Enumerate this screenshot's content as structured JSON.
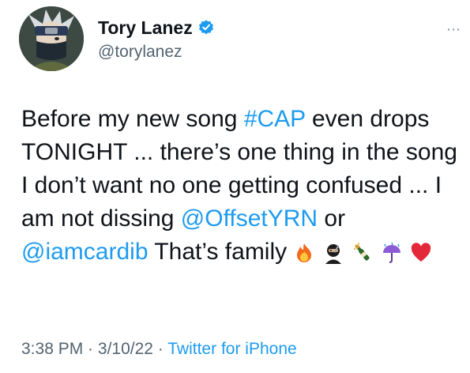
{
  "user": {
    "display_name": "Tory Lanez",
    "handle": "@torylanez",
    "verified": true,
    "avatar_icon": "anime-ninja-avatar"
  },
  "more_icon": "⋯",
  "tweet": {
    "part1": "Before my new song ",
    "hashtag": "#CAP",
    "part2": " even drops TONIGHT  ... there’s one thing in the song I don’t want no one getting confused ... I am not dissing ",
    "mention1": "@OffsetYRN",
    "part3": " or ",
    "mention2": "@iamcardib",
    "part4": "  That’s family",
    "emojis": [
      "fire-emoji",
      "ninja-emoji",
      "champagne-emoji",
      "umbrella-rain-emoji",
      "red-heart-emoji"
    ]
  },
  "meta": {
    "time": "3:38 PM",
    "sep1": " · ",
    "date": "3/10/22",
    "sep2": " · ",
    "source": "Twitter for iPhone"
  },
  "colors": {
    "link": "#1d9bf0",
    "secondary": "#536471",
    "text": "#0f1419"
  }
}
